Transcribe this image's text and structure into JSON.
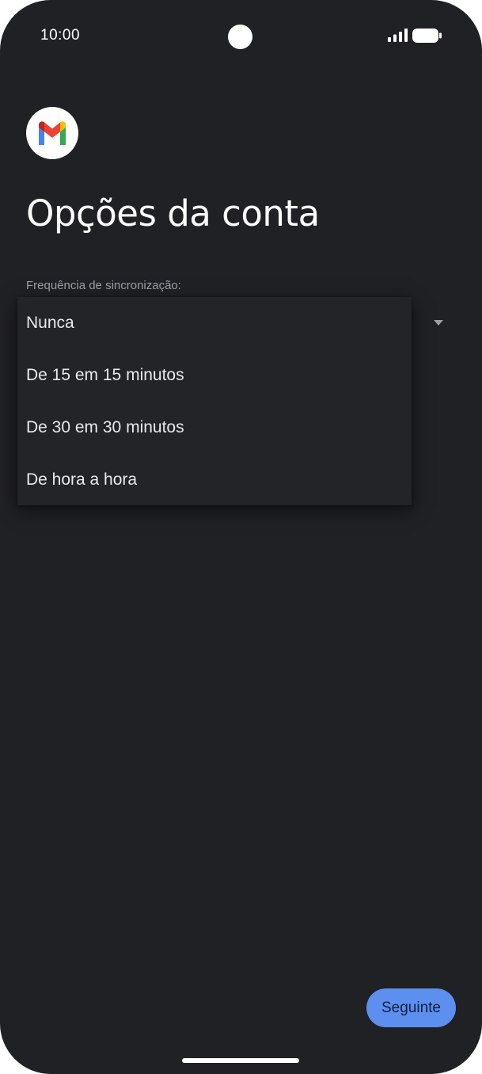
{
  "status_bar": {
    "time": "10:00",
    "signal_icon": "cellular-signal-icon",
    "battery_icon": "battery-full-icon"
  },
  "app": {
    "logo_icon": "gmail-logo-icon"
  },
  "page": {
    "title": "Opções da conta"
  },
  "sync_frequency": {
    "label": "Frequência de sincronização:",
    "arrow_icon": "dropdown-arrow-icon",
    "options": [
      "Nunca",
      "De 15 em 15 minutos",
      "De 30 em 30 minutos",
      "De hora a hora"
    ]
  },
  "footer": {
    "next_label": "Seguinte"
  },
  "colors": {
    "background": "#202125",
    "menu_background": "#232428",
    "accent": "#5d8fef",
    "text_primary": "#ffffff",
    "text_secondary": "#9aa0a6"
  }
}
